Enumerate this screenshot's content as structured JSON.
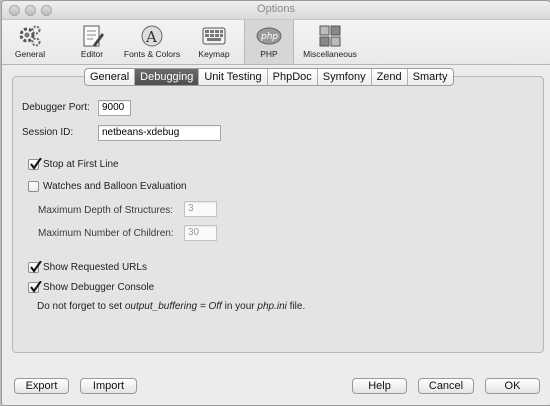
{
  "window": {
    "title": "Options"
  },
  "toolbar": {
    "items": [
      {
        "label": "General",
        "icon": "gear-icon"
      },
      {
        "label": "Editor",
        "icon": "editor-icon"
      },
      {
        "label": "Fonts & Colors",
        "icon": "fonts-colors-icon"
      },
      {
        "label": "Keymap",
        "icon": "keymap-icon"
      },
      {
        "label": "PHP",
        "icon": "php-icon"
      },
      {
        "label": "Miscellaneous",
        "icon": "miscellaneous-icon"
      }
    ],
    "selected": "PHP"
  },
  "tabs": {
    "items": [
      "General",
      "Debugging",
      "Unit Testing",
      "PhpDoc",
      "Symfony",
      "Zend",
      "Smarty"
    ],
    "active": "Debugging"
  },
  "form": {
    "debugger_port": {
      "label": "Debugger Port:",
      "value": "9000"
    },
    "session_id": {
      "label": "Session ID:",
      "value": "netbeans-xdebug"
    },
    "stop_first_line": {
      "label": "Stop at First Line",
      "checked": true
    },
    "watches": {
      "label": "Watches and Balloon Evaluation",
      "checked": false
    },
    "max_depth": {
      "label": "Maximum Depth of Structures:",
      "value": "3"
    },
    "max_children": {
      "label": "Maximum Number of Children:",
      "value": "30"
    },
    "show_urls": {
      "label": "Show Requested URLs",
      "checked": true
    },
    "show_console": {
      "label": "Show Debugger Console",
      "checked": true
    },
    "note": {
      "part1": "Do not forget to set ",
      "part2": "output_buffering = Off",
      "part3": " in your ",
      "part4": "php.ini",
      "part5": " file."
    }
  },
  "buttons": {
    "export": "Export",
    "import": "Import",
    "help": "Help",
    "cancel": "Cancel",
    "ok": "OK"
  }
}
